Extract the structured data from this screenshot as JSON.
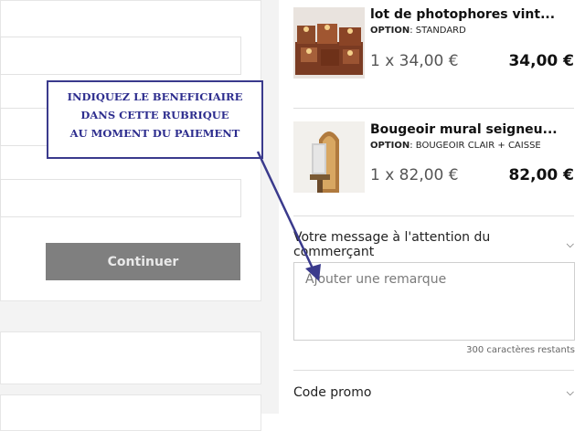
{
  "checkout_form": {
    "continue_label": "Continuer"
  },
  "cart": {
    "items": [
      {
        "name": "lot de photophores vint...",
        "option_label": "OPTION",
        "option_value": ": STANDARD",
        "quantity_price": "1 x 34,00 €",
        "total": "34,00 €",
        "thumb_icon": "photophores-product-image"
      },
      {
        "name": "Bougeoir mural seigneu...",
        "option_label": "OPTION",
        "option_value": ": BOUGEOIR CLAIR + CAISSE",
        "quantity_price": "1 x 82,00 €",
        "total": "82,00 €",
        "thumb_icon": "bougeoir-product-image"
      }
    ]
  },
  "message": {
    "header": "Votre message à l'attention du commerçant",
    "placeholder": "Ajouter une remarque",
    "chars_remaining": "300 caractères restants"
  },
  "promo": {
    "label": "Code promo"
  },
  "annotation": {
    "line1": "INDIQUEZ LE BENEFICIAIRE",
    "line2": "DANS CETTE RUBRIQUE",
    "line3": "AU MOMENT DU PAIEMENT"
  },
  "colors": {
    "annotation": "#2d2d8e",
    "button": "#7f7f7f"
  }
}
